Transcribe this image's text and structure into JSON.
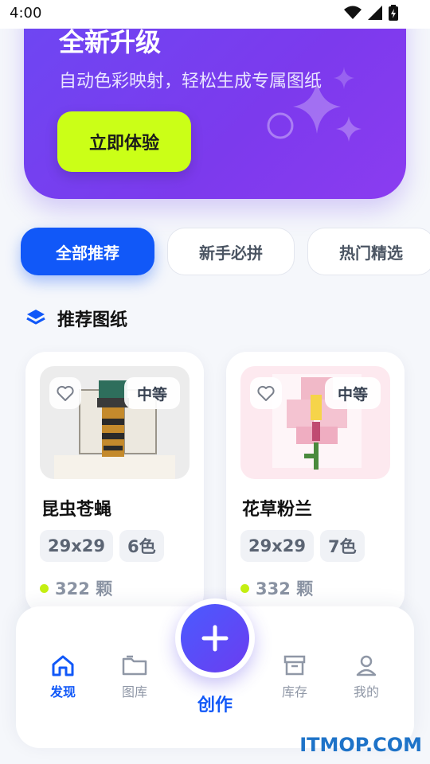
{
  "status_bar": {
    "time": "4:00"
  },
  "banner": {
    "title": "全新升级",
    "subtitle": "自动色彩映射，轻松生成专属图纸",
    "cta_label": "立即体验"
  },
  "tabs": [
    {
      "label": "全部推荐",
      "active": true
    },
    {
      "label": "新手必拼",
      "active": false
    },
    {
      "label": "热门精选",
      "active": false
    }
  ],
  "section": {
    "icon": "layers-icon",
    "title": "推荐图纸"
  },
  "cards": [
    {
      "name": "昆虫苍蝇",
      "level": "中等",
      "size": "29x29",
      "colors": "6色",
      "beads": "322 颗"
    },
    {
      "name": "花草粉兰",
      "level": "中等",
      "size": "29x29",
      "colors": "7色",
      "beads": "332 颗"
    }
  ],
  "bottom_nav": {
    "items": [
      {
        "label": "发现",
        "icon": "home-icon",
        "active": true
      },
      {
        "label": "图库",
        "icon": "folder-icon",
        "active": false
      },
      {
        "label": "库存",
        "icon": "archive-icon",
        "active": false
      },
      {
        "label": "我的",
        "icon": "user-icon",
        "active": false
      }
    ],
    "fab_label": "创作"
  },
  "watermark": "ITMOP.COM",
  "colors": {
    "primary": "#1158f8",
    "accent": "#cbff17",
    "banner": "#7c3aed"
  }
}
